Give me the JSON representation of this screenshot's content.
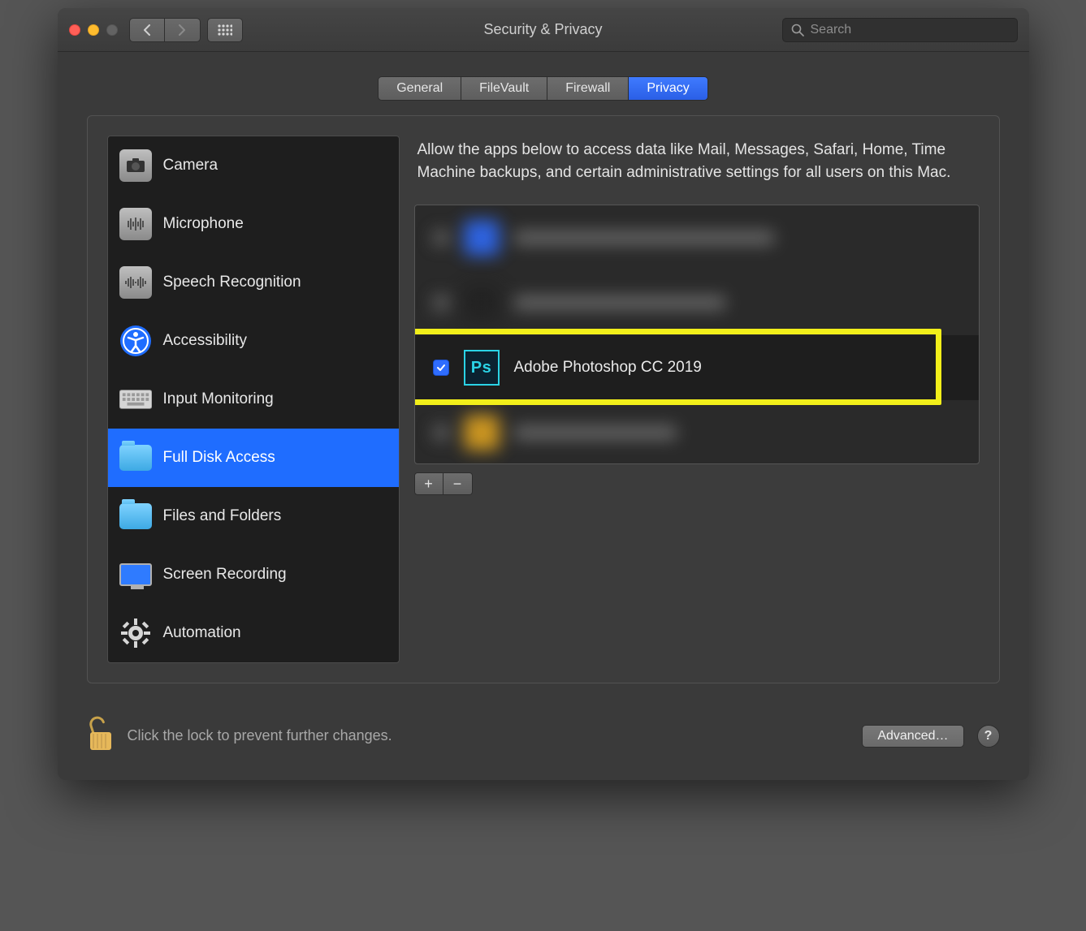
{
  "window": {
    "title": "Security & Privacy",
    "search_placeholder": "Search"
  },
  "tabs": [
    {
      "id": "general",
      "label": "General",
      "active": false
    },
    {
      "id": "filevault",
      "label": "FileVault",
      "active": false
    },
    {
      "id": "firewall",
      "label": "Firewall",
      "active": false
    },
    {
      "id": "privacy",
      "label": "Privacy",
      "active": true
    }
  ],
  "sidebar": {
    "items": [
      {
        "id": "camera",
        "label": "Camera"
      },
      {
        "id": "microphone",
        "label": "Microphone"
      },
      {
        "id": "speech",
        "label": "Speech Recognition"
      },
      {
        "id": "accessibility",
        "label": "Accessibility"
      },
      {
        "id": "input-monitoring",
        "label": "Input Monitoring"
      },
      {
        "id": "full-disk-access",
        "label": "Full Disk Access",
        "selected": true
      },
      {
        "id": "files-folders",
        "label": "Files and Folders"
      },
      {
        "id": "screen-recording",
        "label": "Screen Recording"
      },
      {
        "id": "automation",
        "label": "Automation"
      }
    ]
  },
  "detail": {
    "description": "Allow the apps below to access data like Mail, Messages, Safari, Home, Time Machine backups, and certain administrative settings for all users on this Mac.",
    "highlighted_app": {
      "name": "Adobe Photoshop CC 2019",
      "checked": true,
      "icon_label": "Ps"
    },
    "add_label": "+",
    "remove_label": "−"
  },
  "footer": {
    "lock_hint": "Click the lock to prevent further changes.",
    "advanced_label": "Advanced…",
    "help_label": "?"
  }
}
